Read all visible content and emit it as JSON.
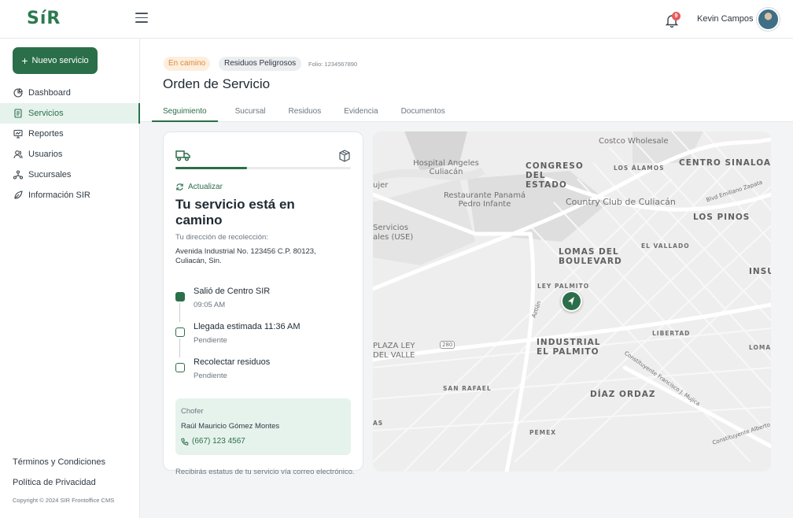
{
  "app": {
    "logo": "SíR",
    "user_name": "Kevin Campos",
    "notifications": "9"
  },
  "sidebar": {
    "new_service_label": "Nuevo servicio",
    "items": [
      {
        "label": "Dashboard",
        "icon": "pie-chart-icon"
      },
      {
        "label": "Servicios",
        "icon": "document-icon",
        "active": true
      },
      {
        "label": "Reportes",
        "icon": "report-icon"
      },
      {
        "label": "Usuarios",
        "icon": "users-icon"
      },
      {
        "label": "Sucursales",
        "icon": "branches-icon"
      },
      {
        "label": "Información SIR",
        "icon": "leaf-icon"
      }
    ],
    "footer": {
      "terms": "Términos y Condiciones",
      "privacy": "Política de Privacidad",
      "copyright": "Copyright © 2024 SIR Frontoffice CMS"
    }
  },
  "header": {
    "status_badge": "En camino",
    "type_badge": "Residuos Peligrosos",
    "folio": "Folio: 1234567890",
    "title": "Orden de Servicio",
    "tabs": [
      "Seguimiento",
      "Sucursal",
      "Residuos",
      "Evidencia",
      "Documentos"
    ],
    "active_tab": "Seguimiento"
  },
  "tracking": {
    "progress": 0.41,
    "refresh_label": "Actualizar",
    "title": "Tu servicio está en camino",
    "address_label": "Tu dirección de recolección:",
    "address": "Avenida Industrial No. 123456 C.P. 80123, Culiacán, Sin.",
    "steps": [
      {
        "title": "Salió de Centro SIR",
        "sub": "09:05 AM",
        "done": true
      },
      {
        "title": "Llegada estimada 11:36 AM",
        "sub": "Pendiente",
        "done": false
      },
      {
        "title": "Recolectar residuos",
        "sub": "Pendiente",
        "done": false
      }
    ],
    "driver_label": "Chofer",
    "driver_name": "Raúl Mauricio Gómez Montes",
    "driver_phone": "(667) 123 4567",
    "note": "Recibirás estatus de tu servicio vía correo electrónico."
  },
  "map": {
    "labels": {
      "costco": "Costco Wholesale",
      "hospital": "Hospital Angeles Culiacán",
      "congreso": "CONGRESO DEL ESTADO",
      "los_alamos": "LOS ÁLAMOS",
      "centro_sinaloa": "CENTRO SINALOA",
      "restaurante": "Restaurante Panamá Pedro Infante",
      "country": "Country Club de Culiacán",
      "blvd": "Blvd Emiliano Zapata",
      "los_pinos": "LOS PINOS",
      "servicios": "Servicios ales (USE)",
      "ujer": "ujer",
      "lomas": "LOMAS DEL BOULEVARD",
      "el_vallado": "EL VALLADO",
      "insu": "INSU",
      "ley_palmito": "LEY PALMITO",
      "aztlan": "Aztlán",
      "plaza_ley": "PLAZA LEY DEL VALLE",
      "road_280": "280",
      "industrial": "INDUSTRIAL EL PALMITO",
      "libertad": "LIBERTAD",
      "loma": "LOMA",
      "constituyente_fm": "Constituyente Francisco J. Mujica",
      "san_rafael": "SAN RAFAEL",
      "diaz_ordaz": "DÍAZ ORDAZ",
      "as": "AS",
      "pemex": "PEMEX",
      "constituyente_alb": "Constituyente Alberto"
    }
  }
}
